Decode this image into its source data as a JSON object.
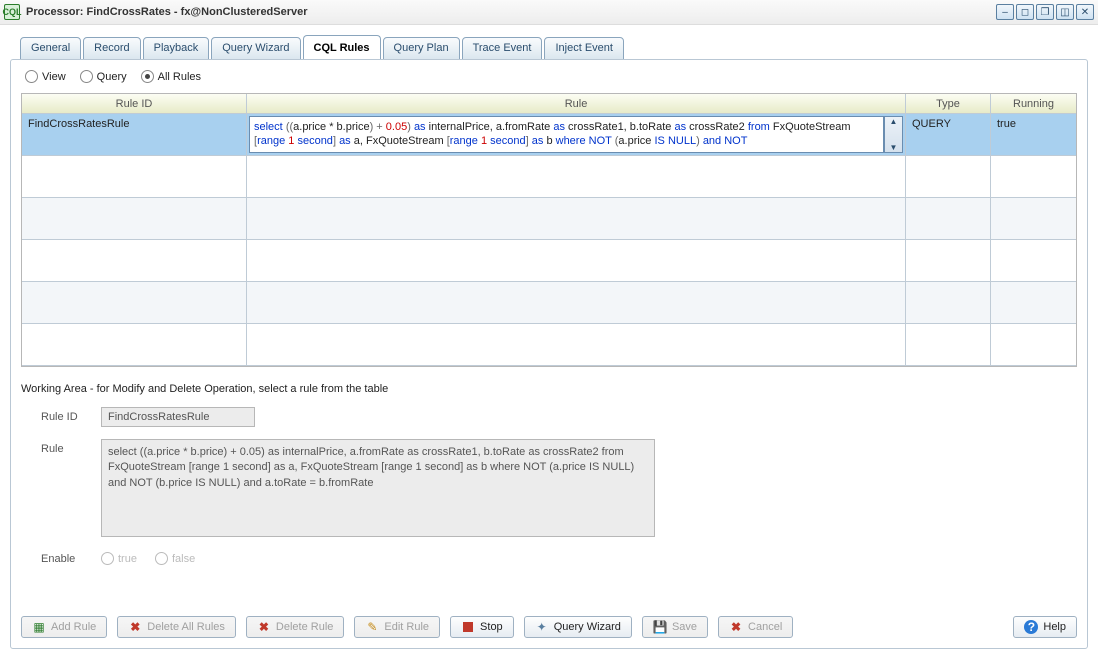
{
  "window": {
    "title": "Processor: FindCrossRates - fx@NonClusteredServer"
  },
  "window_controls": [
    "min",
    "max",
    "restore",
    "close1",
    "close2"
  ],
  "tabs": [
    {
      "id": "general",
      "label": "General",
      "active": false
    },
    {
      "id": "record",
      "label": "Record",
      "active": false
    },
    {
      "id": "playback",
      "label": "Playback",
      "active": false
    },
    {
      "id": "query-wizard",
      "label": "Query Wizard",
      "active": false
    },
    {
      "id": "cql-rules",
      "label": "CQL Rules",
      "active": true
    },
    {
      "id": "query-plan",
      "label": "Query Plan",
      "active": false
    },
    {
      "id": "trace-event",
      "label": "Trace Event",
      "active": false
    },
    {
      "id": "inject-event",
      "label": "Inject Event",
      "active": false
    }
  ],
  "filter_radios": {
    "view_label": "View",
    "query_label": "Query",
    "all_label": "All Rules",
    "selected": "all"
  },
  "grid": {
    "columns": {
      "rule_id": "Rule ID",
      "rule": "Rule",
      "type": "Type",
      "running": "Running"
    },
    "selected_row": {
      "rule_id": "FindCrossRatesRule",
      "rule_text": "select ((a.price * b.price) + 0.05) as internalPrice, a.fromRate as crossRate1, b.toRate as crossRate2 from FxQuoteStream [range 1 second] as a, FxQuoteStream [range 1 second] as b where NOT (a.price IS NULL) and NOT",
      "type": "QUERY",
      "running": "true"
    }
  },
  "working_area_text": "Working Area - for Modify and Delete Operation, select a rule from the table",
  "form": {
    "rule_id_label": "Rule ID",
    "rule_id_value": "FindCrossRatesRule",
    "rule_label": "Rule",
    "rule_value": "select ((a.price * b.price) + 0.05) as internalPrice, a.fromRate as crossRate1, b.toRate as crossRate2 from FxQuoteStream [range 1 second] as a, FxQuoteStream [range 1 second] as b where NOT (a.price IS NULL) and NOT (b.price IS NULL) and a.toRate = b.fromRate",
    "enable_label": "Enable",
    "enable_true": "true",
    "enable_false": "false"
  },
  "toolbar": {
    "add_rule": "Add Rule",
    "delete_all": "Delete All Rules",
    "delete_rule": "Delete Rule",
    "edit_rule": "Edit Rule",
    "stop": "Stop",
    "query_wizard": "Query Wizard",
    "save": "Save",
    "cancel": "Cancel",
    "help": "Help"
  }
}
